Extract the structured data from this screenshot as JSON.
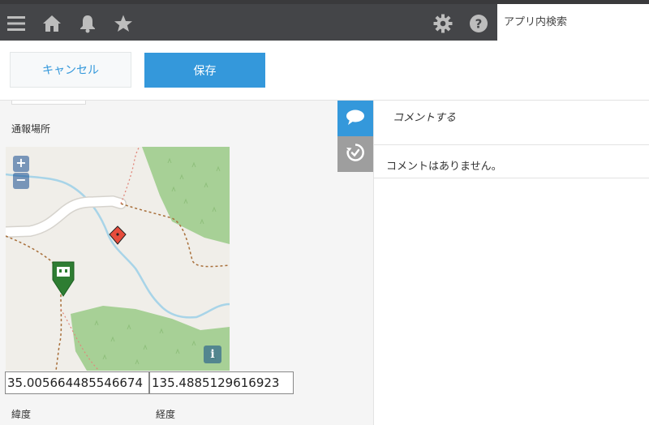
{
  "header": {
    "search_placeholder": "アプリ内検索",
    "icons": [
      "menu-icon",
      "home-icon",
      "bell-icon",
      "star-icon",
      "gear-icon",
      "help-icon"
    ]
  },
  "actions": {
    "cancel_label": "キャンセル",
    "save_label": "保存"
  },
  "form": {
    "location_label": "通報場所",
    "map": {
      "zoom_in": "+",
      "zoom_out": "−",
      "info": "i"
    },
    "latitude_value": "35.005664485546674",
    "longitude_value": "135.4885129616923",
    "latitude_label": "緯度",
    "longitude_label": "経度"
  },
  "sidebar": {
    "comment_tab_icon": "speech-bubble-icon",
    "history_tab_icon": "history-icon"
  },
  "comments": {
    "post_placeholder": "コメントする",
    "empty_message": "コメントはありません。"
  },
  "colors": {
    "topbar": "#444548",
    "accent": "#3498db",
    "map_green": "#a7d096",
    "map_water": "#a8d4e8",
    "marker_red": "#e74c3c",
    "marker_green": "#2e7d32"
  }
}
